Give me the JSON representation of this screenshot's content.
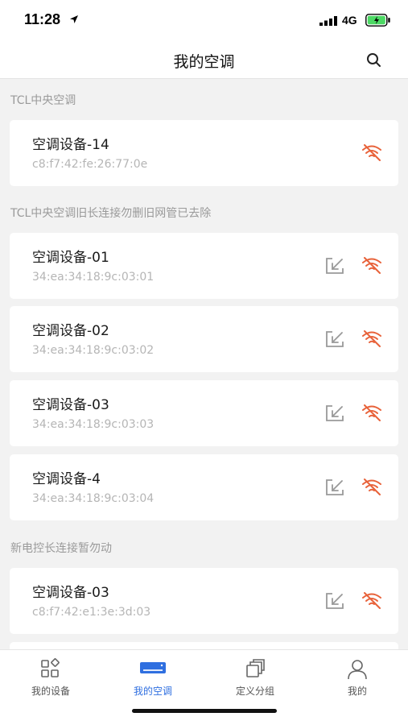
{
  "status_bar": {
    "time": "11:28",
    "network": "4G"
  },
  "nav": {
    "title": "我的空调"
  },
  "sections": [
    {
      "header": "TCL中央空调",
      "devices": [
        {
          "name": "空调设备-14",
          "mac": "c8:f7:42:fe:26:77:0e",
          "status": "offline"
        }
      ]
    },
    {
      "header": "TCL中央空调旧长连接勿删旧网管已去除",
      "devices": [
        {
          "name": "空调设备-01",
          "mac": "34:ea:34:18:9c:03:01",
          "status": "offline"
        },
        {
          "name": "空调设备-02",
          "mac": "34:ea:34:18:9c:03:02",
          "status": "offline"
        },
        {
          "name": "空调设备-03",
          "mac": "34:ea:34:18:9c:03:03",
          "status": "offline"
        },
        {
          "name": "空调设备-4",
          "mac": "34:ea:34:18:9c:03:04",
          "status": "offline"
        }
      ]
    },
    {
      "header": "新电控长连接暂勿动",
      "devices": [
        {
          "name": "空调设备-03",
          "mac": "c8:f7:42:e1:3e:3d:03",
          "status": "offline"
        }
      ]
    }
  ],
  "tabs": [
    {
      "label": "我的设备",
      "icon": "devices-grid-icon"
    },
    {
      "label": "我的空调",
      "icon": "air-conditioner-icon",
      "active": true
    },
    {
      "label": "定义分组",
      "icon": "group-stack-icon"
    },
    {
      "label": "我的",
      "icon": "profile-icon"
    }
  ],
  "colors": {
    "offline": "#e8623a",
    "accent": "#2f6fe0"
  }
}
